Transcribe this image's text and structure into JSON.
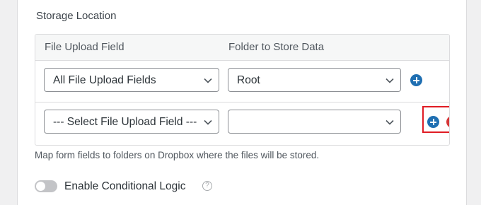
{
  "section": {
    "title": "Storage Location"
  },
  "table": {
    "headers": [
      "File Upload Field",
      "Folder to Store Data"
    ],
    "rows": [
      {
        "upload_field": "All File Upload Fields",
        "folder": "Root"
      },
      {
        "upload_field": "--- Select File Upload Field ---",
        "folder": ""
      }
    ]
  },
  "help_text": "Map form fields to folders on Dropbox where the files will be stored.",
  "conditional": {
    "label": "Enable Conditional Logic",
    "enabled": false,
    "help_glyph": "?"
  },
  "icons": {
    "add": "plus-circle-icon",
    "remove": "minus-circle-icon",
    "dropdown": "chevron-down-icon",
    "help": "question-circle-icon"
  },
  "colors": {
    "add": "#1f6fb2",
    "remove": "#d63638",
    "highlight": "#e01c24"
  }
}
